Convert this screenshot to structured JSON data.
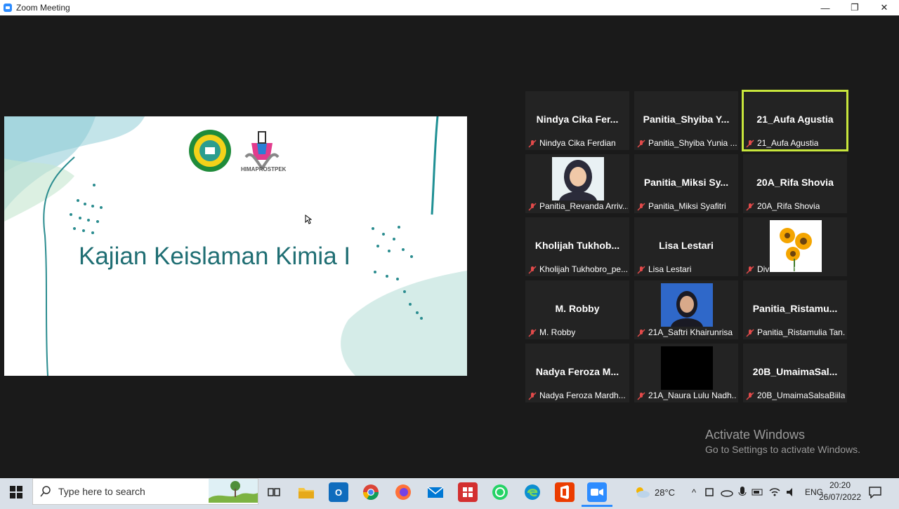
{
  "window": {
    "title": "Zoom Meeting",
    "controls": [
      "—",
      "❐",
      "✕"
    ]
  },
  "slide": {
    "title": "Kajian Keislaman Kimia I",
    "logo_label": "HIMAPROSTPEK"
  },
  "participants": [
    {
      "big": "Nindya Cika Fer...",
      "small": "Nindya Cika Ferdian"
    },
    {
      "big": "Panitia_Shyiba Y...",
      "small": "Panitia_Shyiba Yunia ..."
    },
    {
      "big": "21_Aufa Agustia",
      "small": "21_Aufa Agustia",
      "active": true
    },
    {
      "big": "",
      "small": "Panitia_Revanda Arriv...",
      "avatar": "hijab-photo"
    },
    {
      "big": "Panitia_Miksi Sy...",
      "small": "Panitia_Miksi Syafitri"
    },
    {
      "big": "20A_Rifa Shovia",
      "small": "20A_Rifa Shovia"
    },
    {
      "big": "Kholijah Tukhob...",
      "small": "Kholijah Tukhobro_pe..."
    },
    {
      "big": "Lisa Lestari",
      "small": "Lisa Lestari"
    },
    {
      "big": "",
      "small": "Diva Nurfitria",
      "avatar": "sunflower-photo"
    },
    {
      "big": "M. Robby",
      "small": "M. Robby"
    },
    {
      "big": "",
      "small": "21A_Saftri Khairunrisa",
      "avatar": "portrait-photo"
    },
    {
      "big": "Panitia_Ristamu...",
      "small": "Panitia_Ristamulia Tan..."
    },
    {
      "big": "Nadya Feroza M...",
      "small": "Nadya Feroza Mardh..."
    },
    {
      "big": "",
      "small": "21A_Naura Lulu Nadh...",
      "avatar": "black-video"
    },
    {
      "big": "20B_UmaimaSal...",
      "small": "20B_UmaimaSalsaBiila"
    }
  ],
  "watermark": {
    "line1": "Activate Windows",
    "line2": "Go to Settings to activate Windows."
  },
  "taskbar": {
    "search_placeholder": "Type here to search",
    "weather": "28°C",
    "language": "ENG",
    "time": "20:20",
    "date": "26/07/2022"
  }
}
